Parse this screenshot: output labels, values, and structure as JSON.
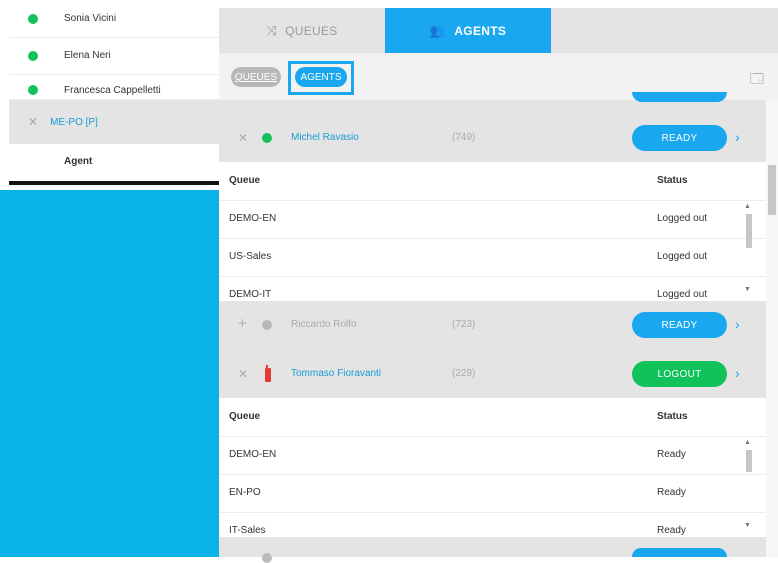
{
  "left_panel": {
    "agents": [
      {
        "name": "Sonia Vicini",
        "status_color": "#11c25b"
      },
      {
        "name": "Elena Neri",
        "status_color": "#11c25b"
      },
      {
        "name": "Francesca Cappelletti",
        "status_color": "#11c25b"
      }
    ],
    "group_label": "ME-PO [P]",
    "agent_header": "Agent"
  },
  "tabs": {
    "queues": "QUEUES",
    "agents": "AGENTS"
  },
  "filter": {
    "queues": "QUEUES",
    "agents": "AGENTS"
  },
  "table_headers": {
    "queue": "Queue",
    "status": "Status"
  },
  "agents": [
    {
      "name": "Michel Ravasio",
      "ext": "(749)",
      "button": "READY",
      "status_icon": "green-dot",
      "queues": [
        {
          "queue": "DEMO-EN",
          "status": "Logged out"
        },
        {
          "queue": "US-Sales",
          "status": "Logged out"
        },
        {
          "queue": "DEMO-IT",
          "status": "Logged out"
        }
      ]
    },
    {
      "name": "Riccardo Rolfo",
      "ext": "(723)",
      "button": "READY",
      "status_icon": "grey-dot"
    },
    {
      "name": "Tommaso Fioravanti",
      "ext": "(229)",
      "button": "LOGOUT",
      "status_icon": "red-phone",
      "queues": [
        {
          "queue": "DEMO-EN",
          "status": "Ready"
        },
        {
          "queue": "EN-PO",
          "status": "Ready"
        },
        {
          "queue": "IT-Sales",
          "status": "Ready"
        }
      ]
    }
  ],
  "colors": {
    "accent": "#19a7ef",
    "green": "#11c25b",
    "red": "#e53935"
  }
}
